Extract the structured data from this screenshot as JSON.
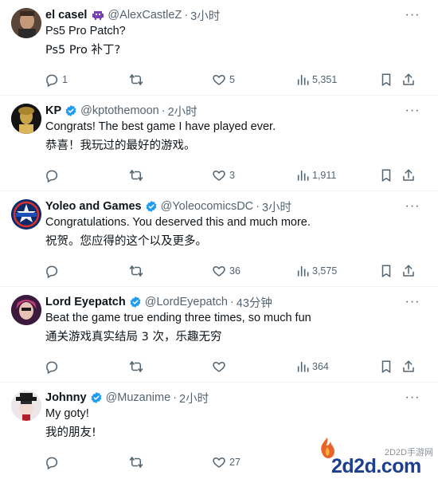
{
  "tweets": [
    {
      "name": "el casel",
      "handle": "@AlexCastleZ",
      "time": "3小时",
      "verified": false,
      "text_en": "Ps5 Pro Patch?",
      "text_zh": "Ps5 Pro 补丁?",
      "replies": "1",
      "retweets": "",
      "likes": "5",
      "views": "5,351"
    },
    {
      "name": "KP",
      "handle": "@kptothemoon",
      "time": "2小时",
      "verified": true,
      "text_en": "Congrats! The best game I have played ever.",
      "text_zh": "恭喜！我玩过的最好的游戏。",
      "replies": "",
      "retweets": "",
      "likes": "3",
      "views": "1,911"
    },
    {
      "name": "Yoleo and Games",
      "handle": "@YoleocomicsDC",
      "time": "3小时",
      "verified": true,
      "text_en": "Congratulations. You deserved this and much more.",
      "text_zh": "祝贺。您应得的这个以及更多。",
      "replies": "",
      "retweets": "",
      "likes": "36",
      "views": "3,575"
    },
    {
      "name": "Lord Eyepatch",
      "handle": "@LordEyepatch",
      "time": "43分钟",
      "verified": true,
      "text_en": "Beat the game true ending three times, so much fun",
      "text_zh": "通关游戏真实结局 3 次，乐趣无穷",
      "replies": "",
      "retweets": "",
      "likes": "",
      "views": "364"
    },
    {
      "name": "Johnny",
      "handle": "@Muzanime",
      "time": "2小时",
      "verified": true,
      "text_en": "My goty!",
      "text_zh": "我的朋友!",
      "replies": "",
      "retweets": "",
      "likes": "27",
      "views": ""
    }
  ],
  "dot": "·",
  "watermark": {
    "site": "2d2d.com",
    "caption": "2D2D手游网"
  },
  "colors": {
    "text_primary": "#0f1419",
    "text_secondary": "#536471",
    "verified_blue": "#1d9bf0",
    "divider": "#eff3f4"
  },
  "icons": {
    "reply": "speech-bubble",
    "retweet": "two-arrows-loop",
    "like": "heart-outline",
    "views": "bar-chart",
    "bookmark": "bookmark-outline",
    "share": "upload-arrow",
    "more": "three-dots"
  }
}
